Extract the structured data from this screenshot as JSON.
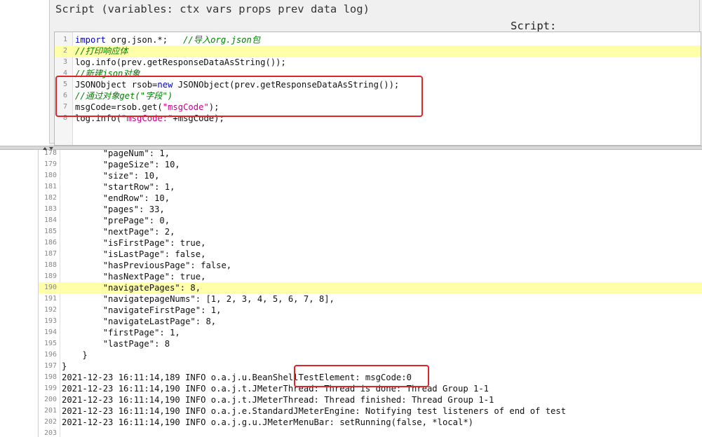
{
  "script_panel": {
    "title": "Script (variables: ctx vars props prev data log)",
    "label": "Script:"
  },
  "editor": {
    "lines": [
      {
        "num": "1",
        "parts": [
          {
            "t": "import",
            "c": "kw"
          },
          {
            "t": " org.json.*;   ",
            "c": ""
          },
          {
            "t": "//导入org.json包",
            "c": "cmt"
          }
        ],
        "hl": false
      },
      {
        "num": "2",
        "parts": [
          {
            "t": "//打印响应体",
            "c": "cmt"
          }
        ],
        "hl": true
      },
      {
        "num": "3",
        "parts": [
          {
            "t": "log.info(prev.getResponseDataAsString());",
            "c": ""
          }
        ],
        "hl": false
      },
      {
        "num": "4",
        "parts": [
          {
            "t": "//新建json对象",
            "c": "cmt"
          }
        ],
        "hl": false
      },
      {
        "num": "5",
        "parts": [
          {
            "t": "JSONObject rsob=",
            "c": ""
          },
          {
            "t": "new",
            "c": "kw"
          },
          {
            "t": " JSONObject(prev.getResponseDataAsString());",
            "c": ""
          }
        ],
        "hl": false
      },
      {
        "num": "6",
        "parts": [
          {
            "t": "//通过对象get(\"字段\")",
            "c": "cmt"
          }
        ],
        "hl": false
      },
      {
        "num": "7",
        "parts": [
          {
            "t": "msgCode=rsob.get(",
            "c": ""
          },
          {
            "t": "\"msgCode\"",
            "c": "str"
          },
          {
            "t": ");",
            "c": ""
          }
        ],
        "hl": false
      },
      {
        "num": "8",
        "parts": [
          {
            "t": "log.info(",
            "c": ""
          },
          {
            "t": "\"msgCode:\"",
            "c": "str"
          },
          {
            "t": "+msgCode);",
            "c": ""
          }
        ],
        "hl": false
      }
    ]
  },
  "log": {
    "lines": [
      {
        "num": "178",
        "text": "        \"pageNum\": 1,",
        "hl": false
      },
      {
        "num": "179",
        "text": "        \"pageSize\": 10,",
        "hl": false
      },
      {
        "num": "180",
        "text": "        \"size\": 10,",
        "hl": false
      },
      {
        "num": "181",
        "text": "        \"startRow\": 1,",
        "hl": false
      },
      {
        "num": "182",
        "text": "        \"endRow\": 10,",
        "hl": false
      },
      {
        "num": "183",
        "text": "        \"pages\": 33,",
        "hl": false
      },
      {
        "num": "184",
        "text": "        \"prePage\": 0,",
        "hl": false
      },
      {
        "num": "185",
        "text": "        \"nextPage\": 2,",
        "hl": false
      },
      {
        "num": "186",
        "text": "        \"isFirstPage\": true,",
        "hl": false
      },
      {
        "num": "187",
        "text": "        \"isLastPage\": false,",
        "hl": false
      },
      {
        "num": "188",
        "text": "        \"hasPreviousPage\": false,",
        "hl": false
      },
      {
        "num": "189",
        "text": "        \"hasNextPage\": true,",
        "hl": false
      },
      {
        "num": "190",
        "text": "        \"navigatePages\": 8,",
        "hl": true
      },
      {
        "num": "191",
        "text": "        \"navigatepageNums\": [1, 2, 3, 4, 5, 6, 7, 8],",
        "hl": false
      },
      {
        "num": "192",
        "text": "        \"navigateFirstPage\": 1,",
        "hl": false
      },
      {
        "num": "193",
        "text": "        \"navigateLastPage\": 8,",
        "hl": false
      },
      {
        "num": "194",
        "text": "        \"firstPage\": 1,",
        "hl": false
      },
      {
        "num": "195",
        "text": "        \"lastPage\": 8",
        "hl": false
      },
      {
        "num": "196",
        "text": "    }",
        "hl": false
      },
      {
        "num": "197",
        "text": "}",
        "hl": false
      },
      {
        "num": "198",
        "text": "2021-12-23 16:11:14,189 INFO o.a.j.u.BeanShellTestElement: msgCode:0",
        "hl": false
      },
      {
        "num": "199",
        "text": "2021-12-23 16:11:14,190 INFO o.a.j.t.JMeterThread: Thread is done: Thread Group 1-1",
        "hl": false
      },
      {
        "num": "200",
        "text": "2021-12-23 16:11:14,190 INFO o.a.j.t.JMeterThread: Thread finished: Thread Group 1-1",
        "hl": false
      },
      {
        "num": "201",
        "text": "2021-12-23 16:11:14,190 INFO o.a.j.e.StandardJMeterEngine: Notifying test listeners of end of test",
        "hl": false
      },
      {
        "num": "202",
        "text": "2021-12-23 16:11:14,190 INFO o.a.j.g.u.JMeterMenuBar: setRunning(false, *local*)",
        "hl": false
      },
      {
        "num": "203",
        "text": "",
        "hl": false
      }
    ]
  },
  "colors": {
    "highlight": "#ffffaa",
    "annotation": "#e0242c",
    "keyword": "#0000c8",
    "string": "#c8008c",
    "comment": "#008000"
  }
}
